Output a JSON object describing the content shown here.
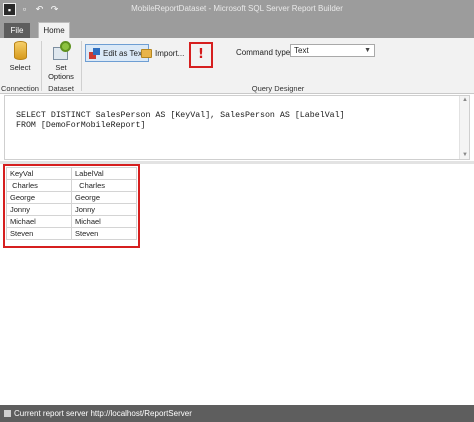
{
  "window": {
    "title": "MobileReportDataset - Microsoft SQL Server Report Builder"
  },
  "tabs": {
    "file": "File",
    "home": "Home"
  },
  "ribbon": {
    "connection": {
      "button": "Select",
      "group": "Connection"
    },
    "dataset": {
      "button_line1": "Set",
      "button_line2": "Options",
      "group": "Dataset"
    },
    "query_designer": {
      "edit_as_text": "Edit as Text",
      "import": "Import...",
      "run_symbol": "!",
      "command_type_label": "Command type:",
      "command_type_value": "Text",
      "group": "Query Designer"
    }
  },
  "query": {
    "line1": "SELECT DISTINCT SalesPerson AS [KeyVal], SalesPerson AS [LabelVal]",
    "line2": "FROM [DemoForMobileReport]"
  },
  "results": {
    "columns": [
      "KeyVal",
      "LabelVal"
    ],
    "rows": [
      [
        " Charles",
        "  Charles"
      ],
      [
        "George",
        "George"
      ],
      [
        "Jonny",
        "Jonny"
      ],
      [
        "Michael",
        "Michael"
      ],
      [
        "Steven",
        "Steven"
      ]
    ]
  },
  "status": {
    "text": "Current report server http://localhost/ReportServer"
  },
  "colors": {
    "highlight": "#d61f1f",
    "chrome": "#9c9c9c",
    "statusbar": "#5e5e5e"
  }
}
